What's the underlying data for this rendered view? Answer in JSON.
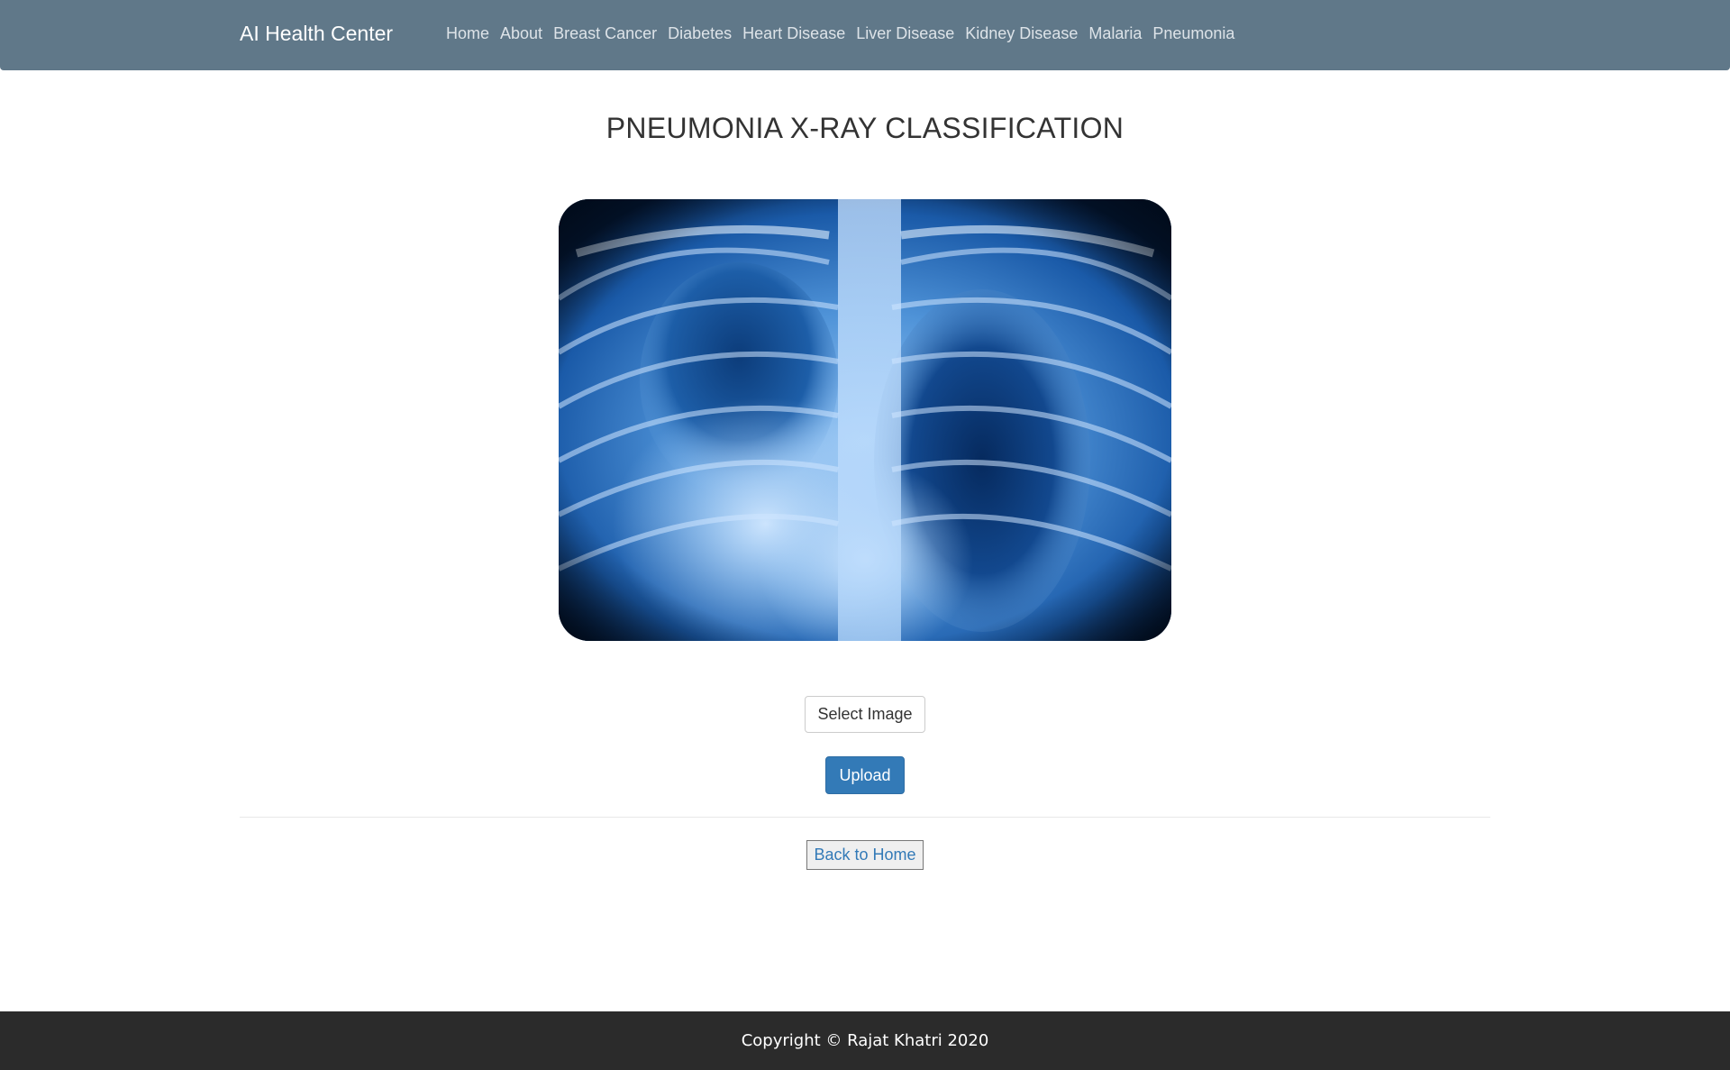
{
  "navbar": {
    "brand": "AI Health Center",
    "items": [
      {
        "label": "Home"
      },
      {
        "label": "About"
      },
      {
        "label": "Breast Cancer"
      },
      {
        "label": "Diabetes"
      },
      {
        "label": "Heart Disease"
      },
      {
        "label": "Liver Disease"
      },
      {
        "label": "Kidney Disease"
      },
      {
        "label": "Malaria"
      },
      {
        "label": "Pneumonia"
      }
    ],
    "background_color": "#607889"
  },
  "main": {
    "title": "PNEUMONIA X-RAY CLASSIFICATION",
    "image": "chest-xray-image",
    "select_image_label": "Select Image",
    "upload_label": "Upload",
    "back_label": "Back to Home"
  },
  "footer": {
    "text": "Copyright © Rajat Khatri 2020",
    "background_color": "#2b2b2b"
  },
  "colors": {
    "primary_button": "#337ab7",
    "link": "#337ab7"
  }
}
